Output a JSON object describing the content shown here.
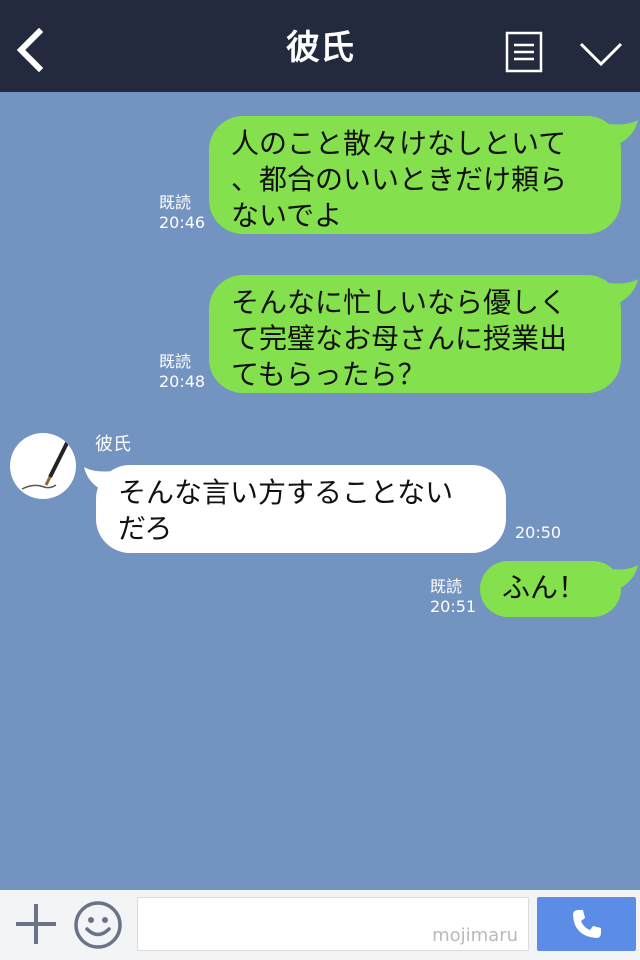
{
  "header": {
    "title": "彼氏",
    "back_icon": "chevron-left-icon",
    "menu_icon": "list-icon",
    "collapse_icon": "chevron-down-icon"
  },
  "messages": [
    {
      "side": "me",
      "text": "人のこと散々けなしといて\n、都合のいいときだけ頼ら\nないでよ",
      "read": "既読",
      "time": "20:46"
    },
    {
      "side": "me",
      "text": "そんなに忙しいなら優しく\nて完璧なお母さんに授業出\nてもらったら？",
      "read": "既読",
      "time": "20:48"
    },
    {
      "side": "them",
      "sender": "彼氏",
      "text": "そんな言い方することない\nだろ",
      "time": "20:50"
    },
    {
      "side": "me",
      "text": "ふん！",
      "read": "既読",
      "time": "20:51"
    }
  ],
  "footer": {
    "plus_icon": "plus-icon",
    "emoji_icon": "smiley-icon",
    "input_value": "",
    "watermark": "mojimaru",
    "call_icon": "phone-icon"
  },
  "colors": {
    "header_bg": "#232a3e",
    "chat_bg": "#7393c1",
    "my_bubble": "#84e04c",
    "their_bubble": "#ffffff",
    "call_button": "#5c8de6"
  }
}
